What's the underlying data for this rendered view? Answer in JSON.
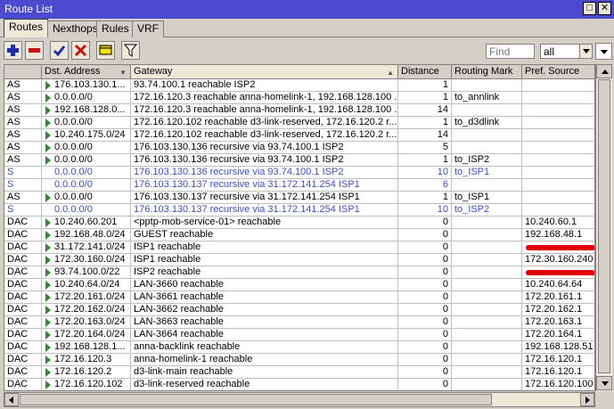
{
  "window": {
    "title": "Route List"
  },
  "tabs": [
    {
      "label": "Routes"
    },
    {
      "label": "Nexthops"
    },
    {
      "label": "Rules"
    },
    {
      "label": "VRF"
    }
  ],
  "toolbar": {
    "buttons": [
      "add",
      "remove",
      "enable",
      "disable",
      "comment",
      "filter"
    ],
    "find_placeholder": "Find",
    "filter_value": "all"
  },
  "columns": [
    "",
    "Dst. Address",
    "Gateway",
    "Distance",
    "Routing Mark",
    "Pref. Source"
  ],
  "colors": {
    "titlebar": "#4e4ad0",
    "static_row_text": "#3d4ec8",
    "active_icon": "#2e8b2e",
    "redaction": "#e00000"
  },
  "routes": [
    {
      "flags": "AS",
      "dst": "176.103.130.1...",
      "gateway": "93.74.100.1 reachable ISP2",
      "distance": "1",
      "mark": "",
      "src": "",
      "blue": false,
      "active": true
    },
    {
      "flags": "AS",
      "dst": "0.0.0.0/0",
      "gateway": "172.16.120.3 reachable anna-homelink-1, 192.168.128.100 ..",
      "distance": "1",
      "mark": "to_annlink",
      "src": "",
      "blue": false,
      "active": true
    },
    {
      "flags": "AS",
      "dst": "192.168.128.0...",
      "gateway": "172.16.120.3 reachable anna-homelink-1, 192.168.128.100 ..",
      "distance": "14",
      "mark": "",
      "src": "",
      "blue": false,
      "active": true
    },
    {
      "flags": "AS",
      "dst": "0.0.0.0/0",
      "gateway": "172.16.120.102 reachable d3-link-reserved, 172.16.120.2 r...",
      "distance": "1",
      "mark": "to_d3dlink",
      "src": "",
      "blue": false,
      "active": true
    },
    {
      "flags": "AS",
      "dst": "10.240.175.0/24",
      "gateway": "172.16.120.102 reachable d3-link-reserved, 172.16.120.2 r...",
      "distance": "14",
      "mark": "",
      "src": "",
      "blue": false,
      "active": true
    },
    {
      "flags": "AS",
      "dst": "0.0.0.0/0",
      "gateway": "176.103.130.136 recursive via 93.74.100.1 ISP2",
      "distance": "5",
      "mark": "",
      "src": "",
      "blue": false,
      "active": true
    },
    {
      "flags": "AS",
      "dst": "0.0.0.0/0",
      "gateway": "176.103.130.136 recursive via 93.74.100.1 ISP2",
      "distance": "1",
      "mark": "to_ISP2",
      "src": "",
      "blue": false,
      "active": true
    },
    {
      "flags": "S",
      "dst": "0.0.0.0/0",
      "gateway": "176.103.130.136 recursive via 93.74.100.1 ISP2",
      "distance": "10",
      "mark": "to_ISP1",
      "src": "",
      "blue": true,
      "active": false
    },
    {
      "flags": "S",
      "dst": "0.0.0.0/0",
      "gateway": "176.103.130.137 recursive via 31.172.141.254 ISP1",
      "distance": "6",
      "mark": "",
      "src": "",
      "blue": true,
      "active": false
    },
    {
      "flags": "AS",
      "dst": "0.0.0.0/0",
      "gateway": "176.103.130.137 recursive via 31.172.141.254 ISP1",
      "distance": "1",
      "mark": "to_ISP1",
      "src": "",
      "blue": false,
      "active": true
    },
    {
      "flags": "S",
      "dst": "0.0.0.0/0",
      "gateway": "176.103.130.137 recursive via 31.172.141.254 ISP1",
      "distance": "10",
      "mark": "to_ISP2",
      "src": "",
      "blue": true,
      "active": false
    },
    {
      "flags": "DAC",
      "dst": "10.240.60.201",
      "gateway": "<pptp-mob-service-01> reachable",
      "distance": "0",
      "mark": "",
      "src": "10.240.60.1",
      "blue": false,
      "active": true
    },
    {
      "flags": "DAC",
      "dst": "192.168.48.0/24",
      "gateway": "GUEST reachable",
      "distance": "0",
      "mark": "",
      "src": "192.168.48.1",
      "blue": false,
      "active": true
    },
    {
      "flags": "DAC",
      "dst": "31.172.141.0/24",
      "gateway": "ISP1 reachable",
      "distance": "0",
      "mark": "",
      "src": "",
      "blue": false,
      "active": true,
      "redacted": true
    },
    {
      "flags": "DAC",
      "dst": "172.30.160.0/24",
      "gateway": "ISP1 reachable",
      "distance": "0",
      "mark": "",
      "src": "172.30.160.240",
      "blue": false,
      "active": true
    },
    {
      "flags": "DAC",
      "dst": "93.74.100.0/22",
      "gateway": "ISP2 reachable",
      "distance": "0",
      "mark": "",
      "src": "",
      "blue": false,
      "active": true,
      "redacted": true
    },
    {
      "flags": "DAC",
      "dst": "10.240.64.0/24",
      "gateway": "LAN-3660 reachable",
      "distance": "0",
      "mark": "",
      "src": "10.240.64.64",
      "blue": false,
      "active": true
    },
    {
      "flags": "DAC",
      "dst": "172.20.161.0/24",
      "gateway": "LAN-3661 reachable",
      "distance": "0",
      "mark": "",
      "src": "172.20.161.1",
      "blue": false,
      "active": true
    },
    {
      "flags": "DAC",
      "dst": "172.20.162.0/24",
      "gateway": "LAN-3662 reachable",
      "distance": "0",
      "mark": "",
      "src": "172.20.162.1",
      "blue": false,
      "active": true
    },
    {
      "flags": "DAC",
      "dst": "172.20.163.0/24",
      "gateway": "LAN-3663 reachable",
      "distance": "0",
      "mark": "",
      "src": "172.20.163.1",
      "blue": false,
      "active": true
    },
    {
      "flags": "DAC",
      "dst": "172.20.164.0/24",
      "gateway": "LAN-3664 reachable",
      "distance": "0",
      "mark": "",
      "src": "172.20.164.1",
      "blue": false,
      "active": true
    },
    {
      "flags": "DAC",
      "dst": "192.168.128.1...",
      "gateway": "anna-backlink reachable",
      "distance": "0",
      "mark": "",
      "src": "192.168.128.51",
      "blue": false,
      "active": true
    },
    {
      "flags": "DAC",
      "dst": "172.16.120.3",
      "gateway": "anna-homelink-1 reachable",
      "distance": "0",
      "mark": "",
      "src": "172.16.120.1",
      "blue": false,
      "active": true
    },
    {
      "flags": "DAC",
      "dst": "172.16.120.2",
      "gateway": "d3-link-main reachable",
      "distance": "0",
      "mark": "",
      "src": "172.16.120.1",
      "blue": false,
      "active": true
    },
    {
      "flags": "DAC",
      "dst": "172.16.120.102",
      "gateway": "d3-link-reserved reachable",
      "distance": "0",
      "mark": "",
      "src": "172.16.120.100",
      "blue": false,
      "active": true
    }
  ]
}
